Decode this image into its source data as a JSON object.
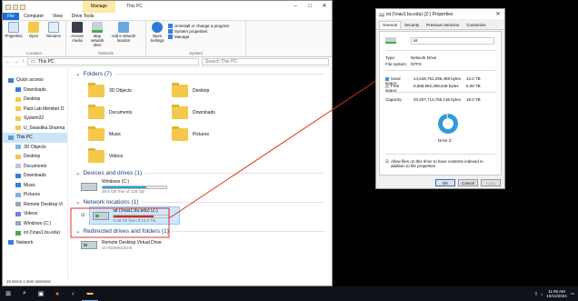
{
  "explorer": {
    "manage_tab": "Manage",
    "title": "This PC",
    "drive_tools": "Drive Tools",
    "tabs": [
      "File",
      "Computer",
      "View"
    ],
    "ribbon": {
      "location": {
        "buttons": [
          "Properties",
          "Open",
          "Rename"
        ],
        "group": "Location"
      },
      "network": {
        "buttons": [
          "Access media",
          "Map network drive",
          "Add a network location"
        ],
        "group": "Network"
      },
      "system": {
        "open_settings": "Open Settings",
        "cmds": [
          "Uninstall or change a program",
          "System properties",
          "Manage"
        ],
        "group": "System"
      }
    },
    "address": "This PC",
    "search_placeholder": "Search This PC",
    "nav": [
      {
        "label": "Quick access",
        "icon": "star-icon",
        "sub": false
      },
      {
        "label": "Downloads",
        "icon": "download-icon",
        "sub": true
      },
      {
        "label": "Desktop",
        "icon": "folder-icon",
        "sub": true
      },
      {
        "label": "Past Lab Member D",
        "icon": "folder-icon",
        "sub": true
      },
      {
        "label": "System32",
        "icon": "folder-icon",
        "sub": true
      },
      {
        "label": "U_Swastika.Sharma",
        "icon": "folder-icon",
        "sub": true
      },
      {
        "label": "This PC",
        "icon": "pc-icon",
        "sub": false,
        "selected": true
      },
      {
        "label": "3D Objects",
        "icon": "cube-icon",
        "sub": true
      },
      {
        "label": "Desktop",
        "icon": "folder-icon",
        "sub": true
      },
      {
        "label": "Documents",
        "icon": "document-icon",
        "sub": true
      },
      {
        "label": "Downloads",
        "icon": "download-icon",
        "sub": true
      },
      {
        "label": "Music",
        "icon": "music-icon",
        "sub": true
      },
      {
        "label": "Pictures",
        "icon": "picture-icon",
        "sub": true
      },
      {
        "label": "Remote Desktop Vi",
        "icon": "drive-icon",
        "sub": true
      },
      {
        "label": "Videos",
        "icon": "video-icon",
        "sub": true
      },
      {
        "label": "Windows (C:)",
        "icon": "drive-icon",
        "sub": true
      },
      {
        "label": "ist (\\\\nas1.bu.edu)",
        "icon": "network-drive-icon",
        "sub": true
      },
      {
        "label": "Network",
        "icon": "network-icon",
        "sub": false
      }
    ],
    "folders_header": "Folders (7)",
    "folders": [
      "3D Objects",
      "Desktop",
      "Documents",
      "Downloads",
      "Music",
      "Pictures",
      "Videos"
    ],
    "devices_header": "Devices and drives (1)",
    "windows_drive": {
      "name": "Windows (C:)",
      "free": "39.6 GB free of 126 GB",
      "used_fraction": 0.69
    },
    "network_header": "Network locations (1)",
    "net_drive": {
      "name": "ist (\\\\nas1.bu.edu) (Z:)",
      "free": "5.08 TB free of 18.3 TB",
      "used_fraction": 0.72
    },
    "redirected_header": "Redirected drives and folders (1)",
    "remote": {
      "name": "Remote Desktop Virtual Drive",
      "sub": "on RDWebClient"
    },
    "status": "10 items   1 item selected"
  },
  "dialog": {
    "title": "ist (\\\\nas1.bu.edu) (Z:) Properties",
    "tabs": [
      "General",
      "Security",
      "Previous Versions",
      "Customize"
    ],
    "name_value": "ist",
    "type_label": "Type:",
    "type_value": "Network Drive",
    "fs_label": "File system:",
    "fs_value": "NTFS",
    "used_label": "Used space:",
    "used_bytes": "14,618,751,295,488 bytes",
    "used_h": "13.2 TB",
    "free_label": "Free space:",
    "free_bytes": "5,588,962,459,648 bytes",
    "free_h": "5.08 TB",
    "cap_label": "Capacity:",
    "cap_bytes": "20,207,713,755,136 bytes",
    "cap_h": "18.3 TB",
    "drive_label": "Drive Z:",
    "allow_index": "Allow files on this drive to have contents indexed in addition to file properties",
    "buttons": [
      "OK",
      "Cancel",
      "Apply"
    ],
    "used_color": "#2f9ad9",
    "free_color": "#c7c7c7"
  },
  "taskbar": {
    "time": "11:09 AM",
    "date": "10/10/2024"
  }
}
